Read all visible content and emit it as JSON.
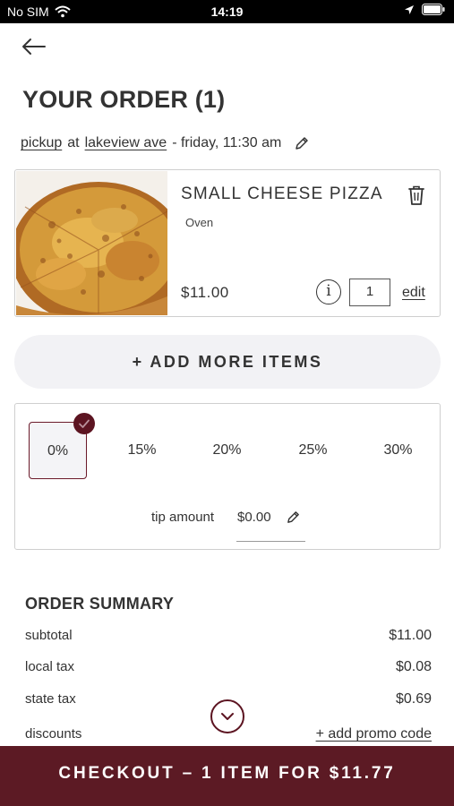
{
  "status_bar": {
    "carrier": "No SIM",
    "time": "14:19"
  },
  "header": {
    "title": "YOUR ORDER (1)"
  },
  "order_meta": {
    "mode": "pickup",
    "at": "at",
    "location": "lakeview ave",
    "when": "- friday, 11:30 am"
  },
  "item": {
    "name": "SMALL CHEESE PIZZA",
    "option": "Oven",
    "price": "$11.00",
    "info_glyph": "i",
    "quantity": "1",
    "edit_label": "edit"
  },
  "add_more_label": "+ ADD MORE ITEMS",
  "tip": {
    "options": [
      "0%",
      "15%",
      "20%",
      "25%",
      "30%"
    ],
    "selected": "0%",
    "amount_label": "tip amount",
    "amount_value": "$0.00"
  },
  "summary": {
    "title": "ORDER SUMMARY",
    "subtotal_label": "subtotal",
    "subtotal_value": "$11.00",
    "local_tax_label": "local tax",
    "local_tax_value": "$0.08",
    "state_tax_label": "state tax",
    "state_tax_value": "$0.69",
    "discounts_label": "discounts",
    "promo_label": "+ add promo code"
  },
  "checkout_label": "CHECKOUT – 1 ITEM FOR $11.77",
  "colors": {
    "accent": "#5c1a24",
    "button_bg": "#f2f2f5",
    "border": "#cfcfcf"
  }
}
